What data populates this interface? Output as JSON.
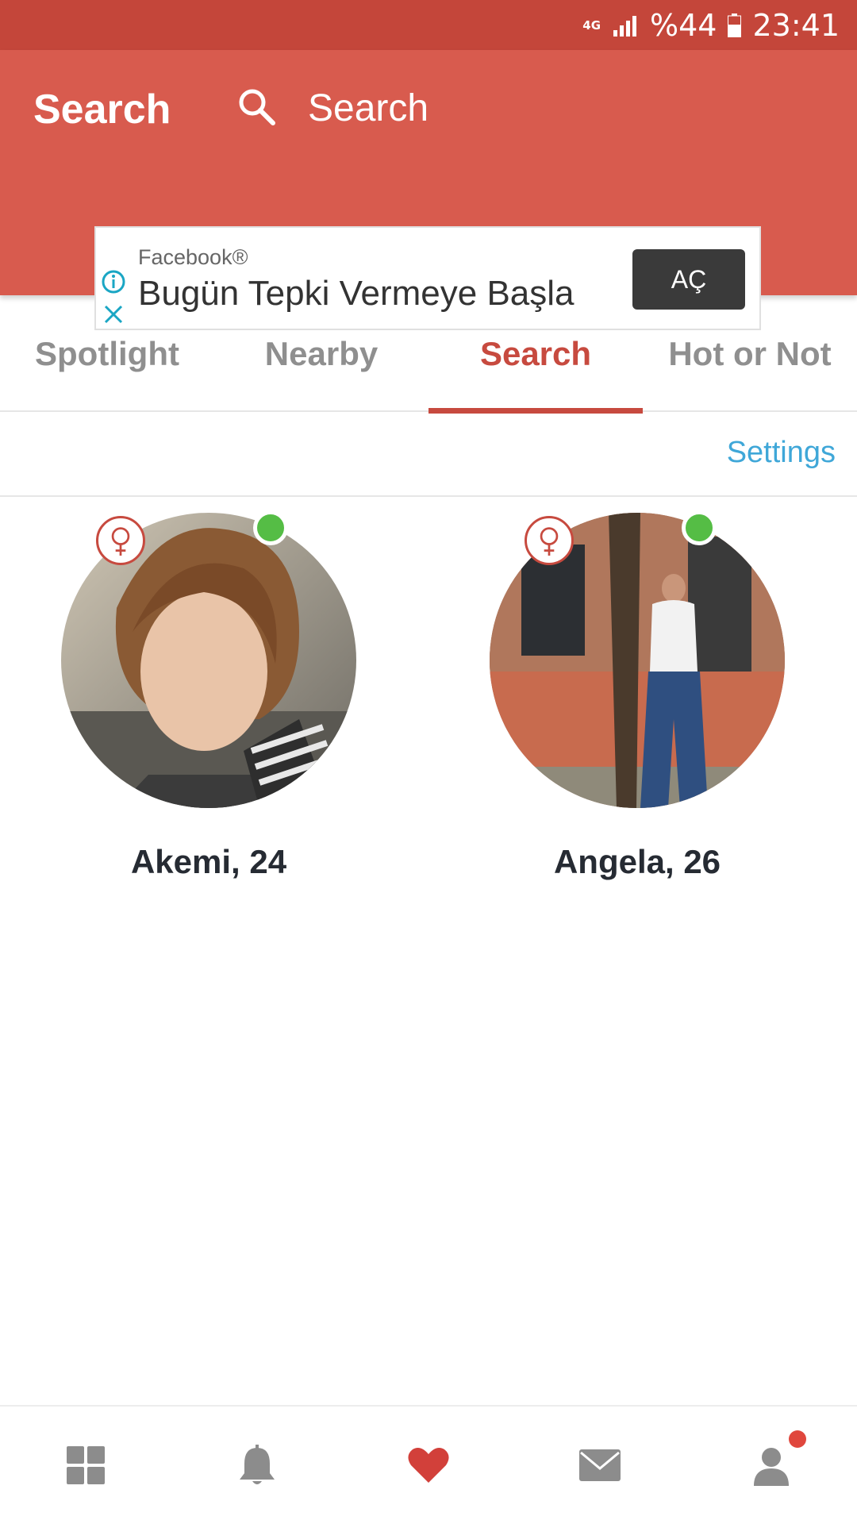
{
  "status_bar": {
    "network": "4G",
    "battery": "%44",
    "time": "23:41"
  },
  "header": {
    "title": "Search",
    "search_placeholder": "Search"
  },
  "ad": {
    "source": "Facebook®",
    "headline": "Bugün Tepki Vermeye Başla",
    "button": "AÇ"
  },
  "tabs": [
    {
      "label": "Spotlight",
      "active": false
    },
    {
      "label": "Nearby",
      "active": false
    },
    {
      "label": "Search",
      "active": true
    },
    {
      "label": "Hot or Not",
      "active": false
    }
  ],
  "settings_label": "Settings",
  "profiles": [
    {
      "name": "Akemi, 24",
      "gender": "female",
      "online": true
    },
    {
      "name": "Angela, 26",
      "gender": "female",
      "online": true
    }
  ],
  "bottom_nav": [
    {
      "icon": "grid-icon",
      "active": false
    },
    {
      "icon": "bell-icon",
      "active": false
    },
    {
      "icon": "heart-icon",
      "active": true
    },
    {
      "icon": "mail-icon",
      "active": false
    },
    {
      "icon": "profile-icon",
      "active": false,
      "badge": true
    }
  ],
  "colors": {
    "primary": "#d85b4e",
    "primary_dark": "#c4463a",
    "accent": "#c74a3f",
    "link": "#3fa7d8",
    "online": "#55bd45"
  }
}
